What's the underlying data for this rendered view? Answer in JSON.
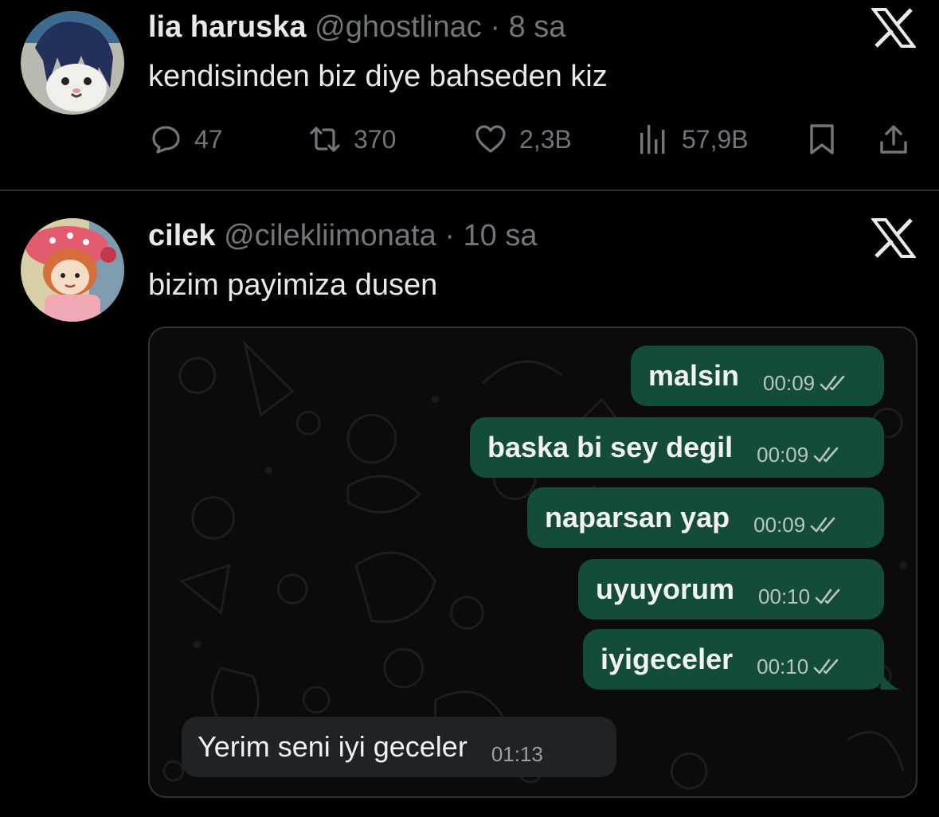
{
  "tweets": [
    {
      "name": "lia haruska",
      "handle": "@ghostlinac",
      "separator": "·",
      "time": "8 sa",
      "text": "kendisinden biz diye bahseden kiz",
      "actions": {
        "replies": "47",
        "retweets": "370",
        "likes": "2,3B",
        "views": "57,9B"
      }
    },
    {
      "name": "cilek",
      "handle": "@cilekliimonata",
      "separator": "·",
      "time": "10 sa",
      "text": "bizim payimiza dusen"
    }
  ],
  "chat": {
    "outgoing": [
      {
        "text": "malsin",
        "time": "00:09"
      },
      {
        "text": "baska bi sey degil",
        "time": "00:09"
      },
      {
        "text": "naparsan yap",
        "time": "00:09"
      },
      {
        "text": "uyuyorum",
        "time": "00:10"
      },
      {
        "text": "iyigeceler",
        "time": "00:10"
      }
    ],
    "incoming": [
      {
        "text": "Yerim seni iyi geceler",
        "time": "01:13"
      }
    ]
  },
  "icons": {
    "platform_logo": "x-logo-icon",
    "reply": "reply-bubble-icon",
    "retweet": "retweet-icon",
    "like": "heart-icon",
    "views": "views-bars-icon",
    "bookmark": "bookmark-icon",
    "share": "share-upload-icon",
    "read_receipt": "double-check-icon"
  },
  "colors": {
    "background": "#000000",
    "text_primary": "#e7e9ea",
    "text_secondary": "#71767b",
    "outgoing_bubble": "#134d37",
    "incoming_bubble": "#1f2326"
  }
}
